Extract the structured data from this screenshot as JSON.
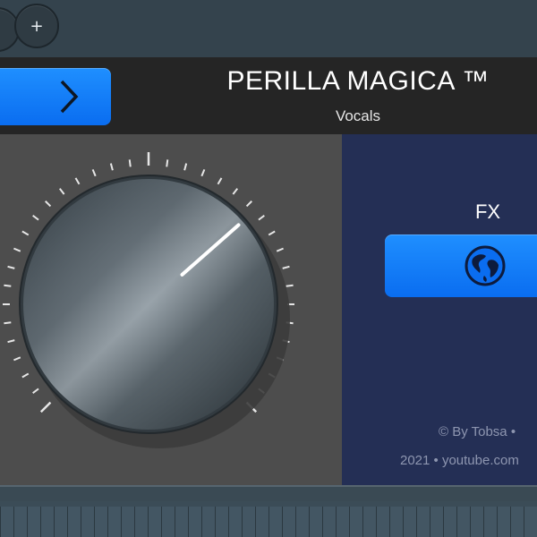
{
  "topbar": {
    "left_button_icon": "circle-button",
    "add_button_label": "+"
  },
  "header": {
    "next_button_icon": "chevron-right-icon",
    "title": "PERILLA MAGICA ™",
    "subtitle": "Vocals"
  },
  "knob": {
    "name": "main-knob",
    "value_fraction": 0.68
  },
  "fx": {
    "label": "FX",
    "button_icon": "globe-icon"
  },
  "credits": {
    "line1": "© By Tobsa •",
    "line2": "2021  •  youtube.com"
  },
  "colors": {
    "accent_blue": "#0a7cff",
    "fx_panel": "#242f55",
    "knob_panel": "#4d4d4d",
    "header": "#252525"
  }
}
